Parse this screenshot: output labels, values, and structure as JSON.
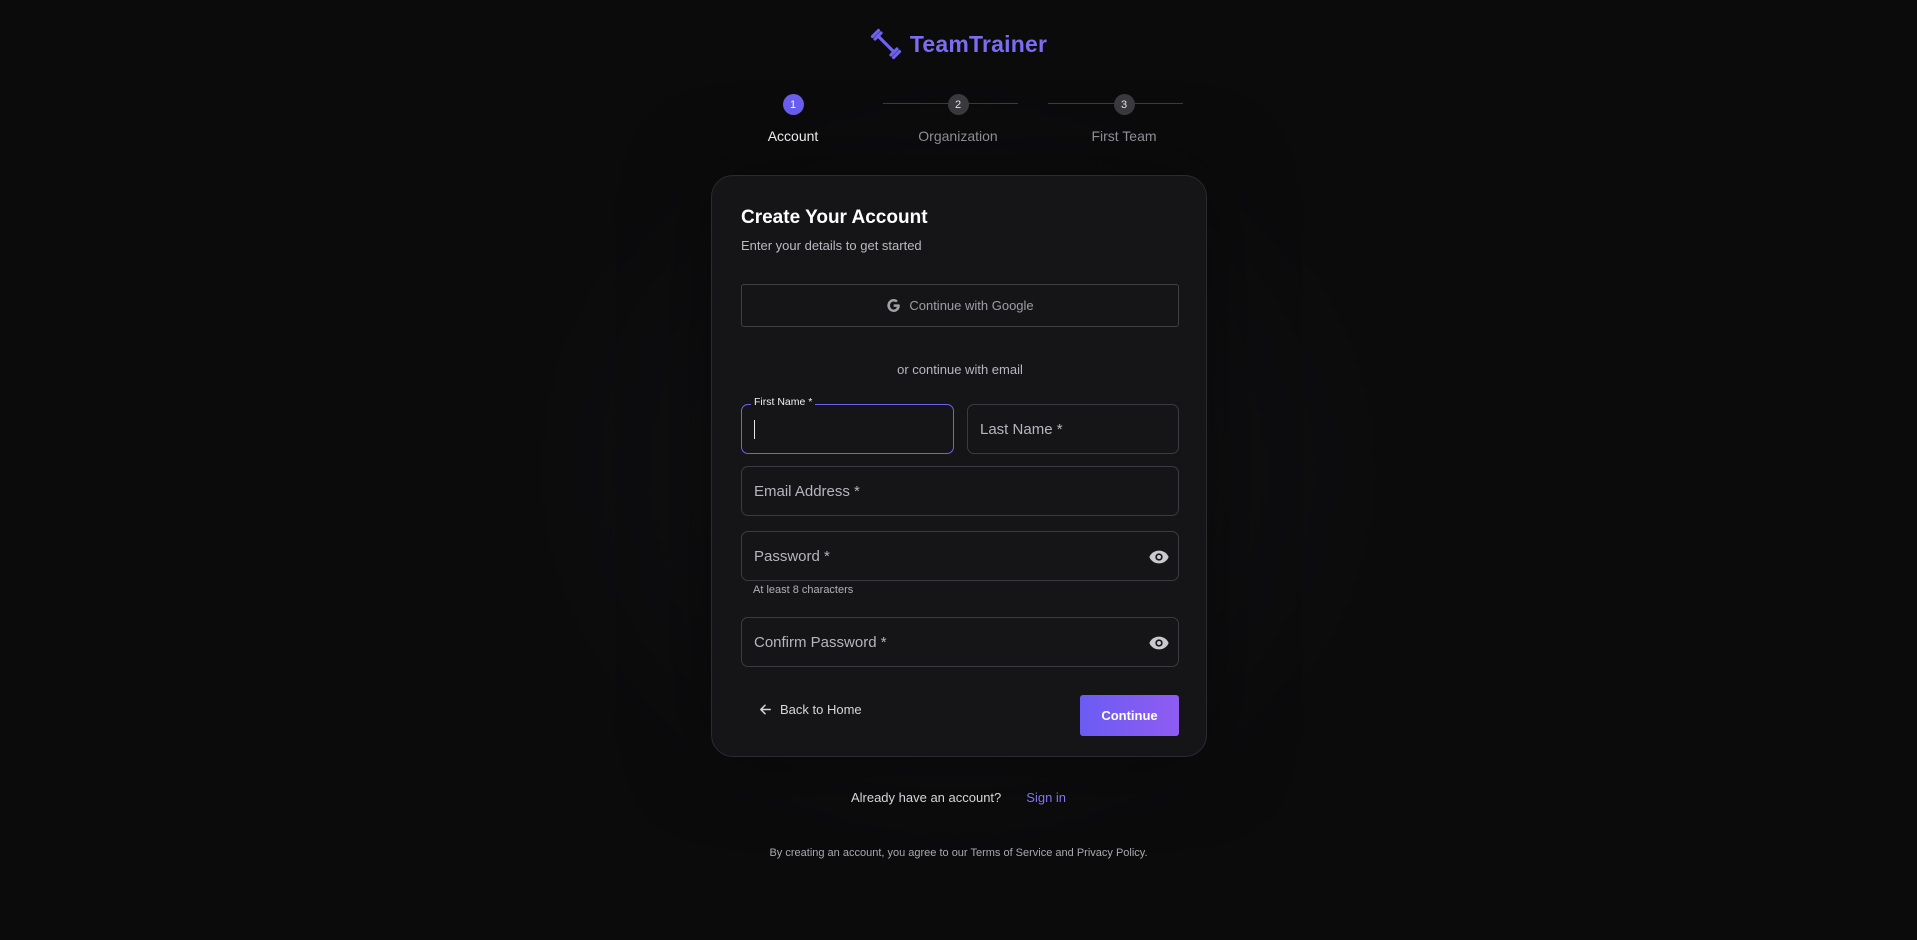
{
  "brand": {
    "name": "TeamTrainer",
    "icon": "dumbbell-icon",
    "accent_color": "#7b6cf0"
  },
  "stepper": {
    "current_step": 1,
    "steps": [
      {
        "number": "1",
        "label": "Account"
      },
      {
        "number": "2",
        "label": "Organization"
      },
      {
        "number": "3",
        "label": "First Team"
      }
    ]
  },
  "card": {
    "title": "Create Your Account",
    "subtitle": "Enter your details to get started",
    "google_button": {
      "label": "Continue with Google",
      "icon": "google-icon"
    },
    "divider_text": "or continue with email",
    "fields": {
      "first_name": {
        "label": "First Name *",
        "value": "",
        "focused": true
      },
      "last_name": {
        "label": "Last Name *",
        "value": ""
      },
      "email": {
        "label": "Email Address *",
        "value": ""
      },
      "password": {
        "label": "Password *",
        "value": "",
        "helper": "At least 8 characters"
      },
      "confirm_password": {
        "label": "Confirm Password *",
        "value": ""
      }
    },
    "back_button": {
      "label": "Back to Home",
      "icon": "arrow-left-icon"
    },
    "continue_button": {
      "label": "Continue"
    }
  },
  "footer": {
    "signin_question": "Already have an account?",
    "signin_link": "Sign in",
    "legal": "By creating an account, you agree to our Terms of Service and Privacy Policy."
  }
}
